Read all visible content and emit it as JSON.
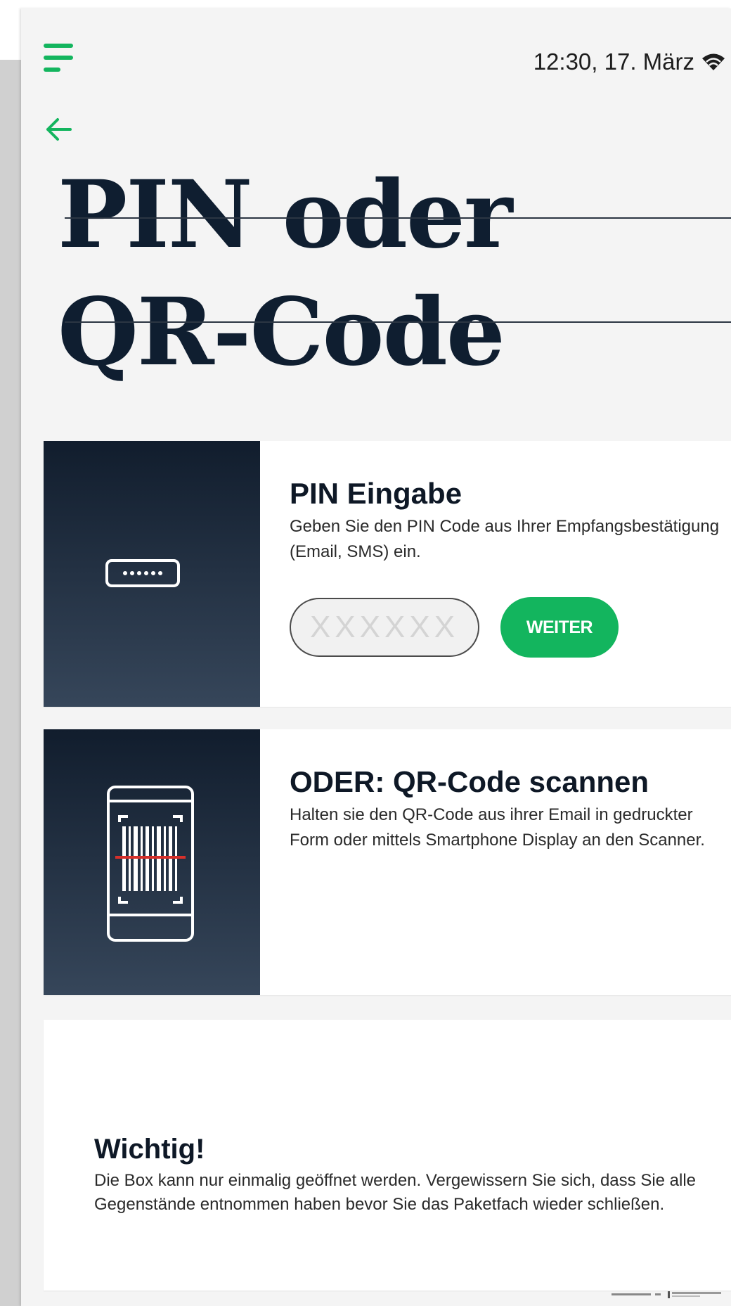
{
  "status": {
    "time_date": "12:30, 17. März",
    "wifi_icon": "wifi-icon"
  },
  "header": {
    "menu_icon": "menu-icon",
    "back_icon": "arrow-left-icon"
  },
  "title": {
    "line1": "PIN oder",
    "line2": "QR-Code"
  },
  "pin_card": {
    "icon": "pin-field-icon",
    "title": "PIN Eingabe",
    "description": "Geben Sie den PIN Code aus Ihrer Empfangsbestätigung (Email, SMS) ein.",
    "input_placeholder": "XXXXXX",
    "button_label": "WEITER"
  },
  "qr_card": {
    "icon": "phone-barcode-scan-icon",
    "title": "ODER: QR-Code scannen",
    "description": "Halten sie den QR-Code aus ihrer Email in gedruckter Form oder mittels Smartphone Display an den Scanner."
  },
  "info_card": {
    "title": "Wichtig!",
    "text": "Die Box kann nur einmalig geöffnet werden. Vergewissern Sie sich, dass Sie alle Gegenstände entnommen haben bevor Sie das Paketfach wieder schließen."
  },
  "colors": {
    "accent_green": "#13b55e",
    "navy": "#0f1e30",
    "scan_line_red": "#d6302b",
    "background": "#f4f4f4"
  }
}
